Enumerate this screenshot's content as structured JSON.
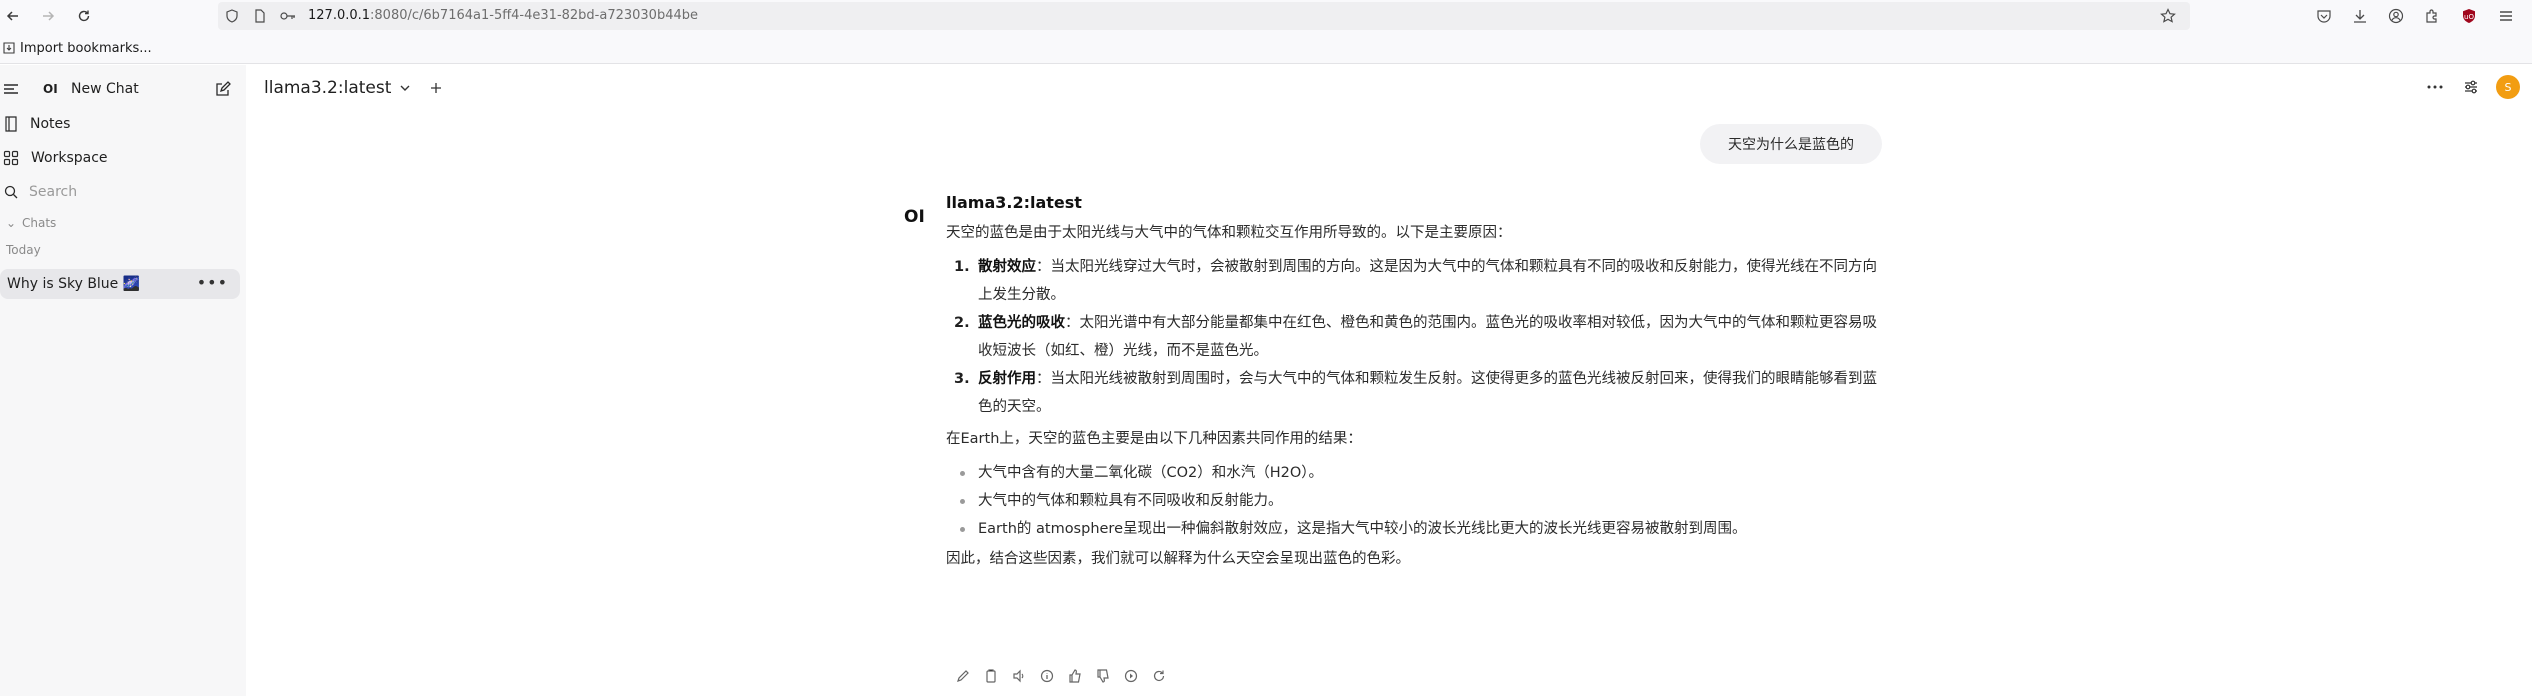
{
  "browser": {
    "url_host": "127.0.0.1",
    "url_rest": ":8080/c/6b7164a1-5ff4-4e31-82bd-a723030b44be",
    "bookmark_label": "Import bookmarks..."
  },
  "sidebar": {
    "new_chat_logo": "OI",
    "new_chat_label": "New Chat",
    "items": [
      {
        "label": "Notes",
        "icon": "notes-icon"
      },
      {
        "label": "Workspace",
        "icon": "workspace-icon"
      }
    ],
    "search_placeholder": "Search",
    "chats_section": "Chats",
    "today_section": "Today",
    "chat_item_title": "Why is Sky Blue 🌌"
  },
  "header": {
    "model_name": "llama3.2:latest",
    "avatar_initial": "S"
  },
  "chat": {
    "user_message": "天空为什么是蓝色的",
    "assistant_logo": "OI",
    "assistant_name": "llama3.2:latest",
    "intro": "天空的蓝色是由于太阳光线与大气中的气体和颗粒交互作用所导致的。以下是主要原因：",
    "ordered": [
      {
        "num": "1.",
        "title": "散射效应",
        "text": "：当太阳光线穿过大气时，会被散射到周围的方向。这是因为大气中的气体和颗粒具有不同的吸收和反射能力，使得光线在不同方向上发生分散。"
      },
      {
        "num": "2.",
        "title": "蓝色光的吸收",
        "text": "：太阳光谱中有大部分能量都集中在红色、橙色和黄色的范围内。蓝色光的吸收率相对较低，因为大气中的气体和颗粒更容易吸收短波长（如红、橙）光线，而不是蓝色光。"
      },
      {
        "num": "3.",
        "title": "反射作用",
        "text": "：当太阳光线被散射到周围时，会与大气中的气体和颗粒发生反射。这使得更多的蓝色光线被反射回来，使得我们的眼睛能够看到蓝色的天空。"
      }
    ],
    "middle": "在Earth上，天空的蓝色主要是由以下几种因素共同作用的结果：",
    "bullets": [
      "大气中含有的大量二氧化碳（CO2）和水汽（H2O）。",
      "大气中的气体和颗粒具有不同吸收和反射能力。",
      "Earth的 atmosphere呈现出一种偏斜散射效应，这是指大气中较小的波长光线比更大的波长光线更容易被散射到周围。"
    ],
    "conclusion": "因此，结合这些因素，我们就可以解释为什么天空会呈现出蓝色的色彩。"
  }
}
